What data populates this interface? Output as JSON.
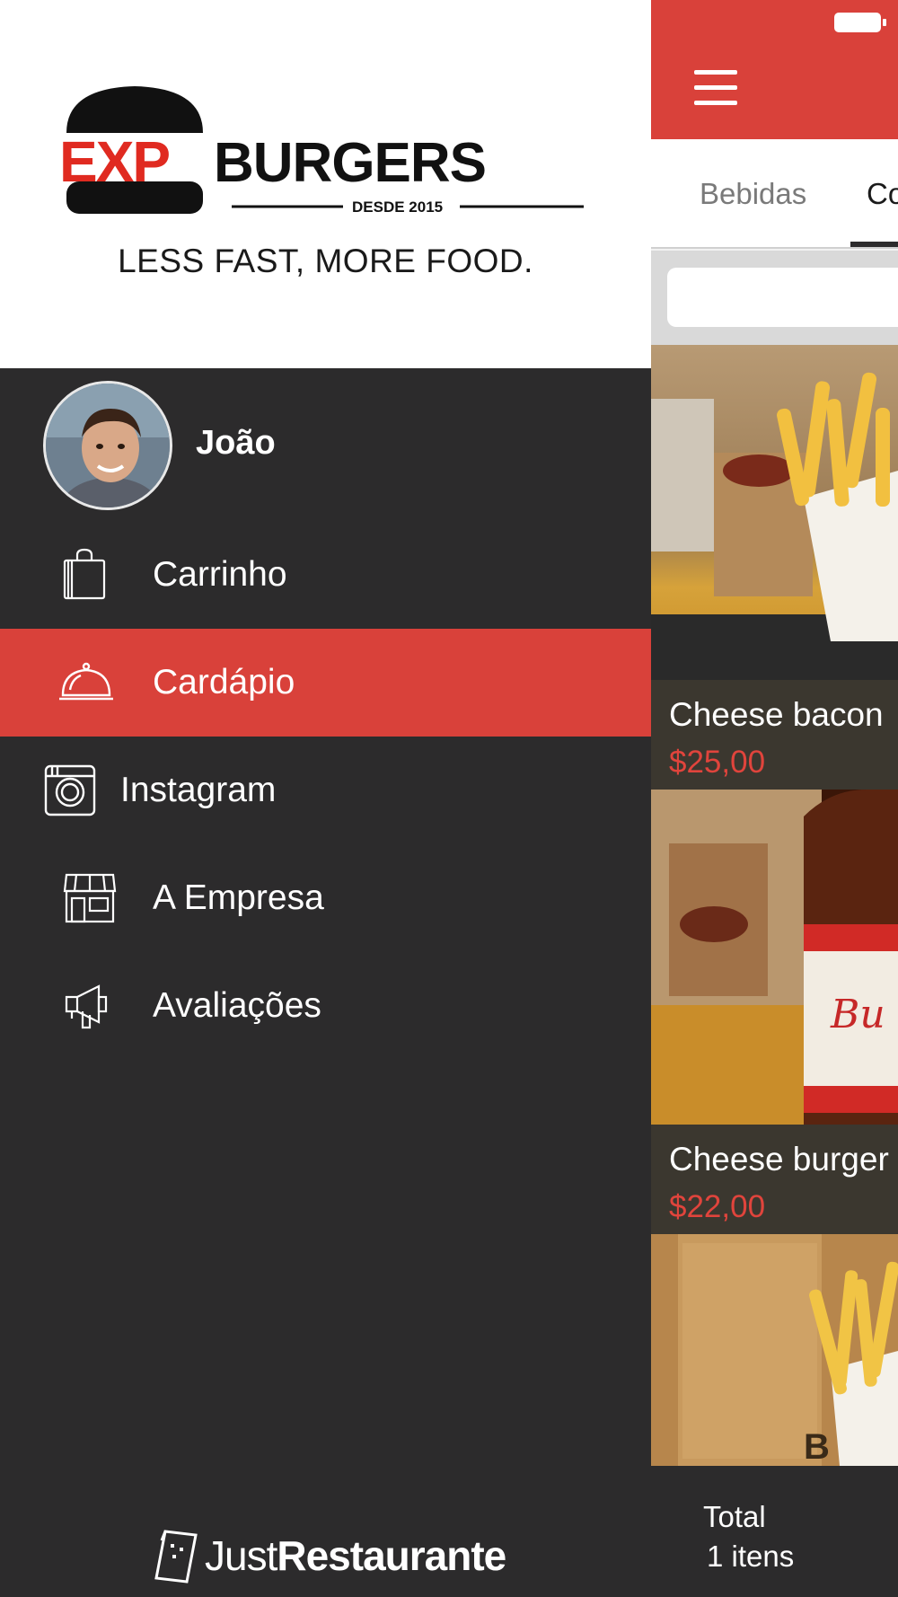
{
  "brand": {
    "logo_exp": "EXP",
    "logo_burgers": "BURGERS",
    "logo_since": "DESDE 2015",
    "tagline": "LESS FAST, MORE FOOD."
  },
  "user": {
    "name": "João"
  },
  "menu": {
    "items": [
      {
        "label": "Carrinho",
        "icon": "shopping-bag-icon"
      },
      {
        "label": "Cardápio",
        "icon": "food-cloche-icon",
        "active": true
      },
      {
        "label": "Instagram",
        "icon": "instagram-icon"
      },
      {
        "label": "A Empresa",
        "icon": "storefront-icon"
      },
      {
        "label": "Avaliações",
        "icon": "megaphone-icon"
      }
    ]
  },
  "footer": {
    "brand_light": "Just",
    "brand_bold": "Restaurante"
  },
  "tabs": {
    "inactive": "Bebidas",
    "active": "Co"
  },
  "search": {
    "placeholder": ""
  },
  "products": [
    {
      "name": "Cheese bacon",
      "price": "$25,00"
    },
    {
      "name": "Cheese burger",
      "price": "$22,00"
    }
  ],
  "cart": {
    "total_label": "Total",
    "items_label": "1 itens"
  },
  "colors": {
    "accent": "#d9413a",
    "drawer_bg": "#2c2b2c",
    "price": "#e0443c"
  }
}
